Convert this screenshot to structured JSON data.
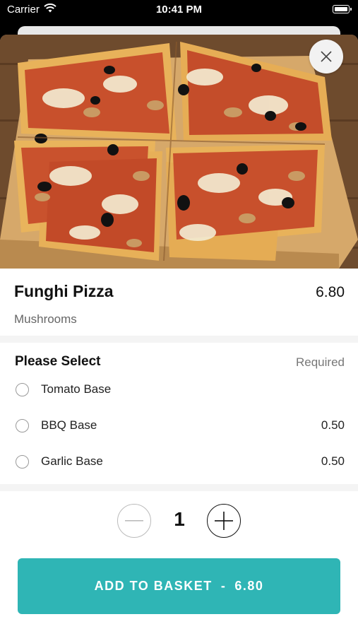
{
  "status_bar": {
    "carrier": "Carrier",
    "time": "10:41 PM"
  },
  "product": {
    "name": "Funghi Pizza",
    "price": "6.80",
    "description": "Mushrooms"
  },
  "options_section": {
    "title": "Please Select",
    "required_label": "Required",
    "options": [
      {
        "label": "Tomato Base",
        "price": ""
      },
      {
        "label": "BBQ Base",
        "price": "0.50"
      },
      {
        "label": "Garlic Base",
        "price": "0.50"
      }
    ]
  },
  "quantity": {
    "value": "1"
  },
  "add_button": {
    "label": "ADD TO BASKET",
    "separator": "-",
    "price": "6.80"
  },
  "colors": {
    "accent": "#2fb5b5"
  }
}
